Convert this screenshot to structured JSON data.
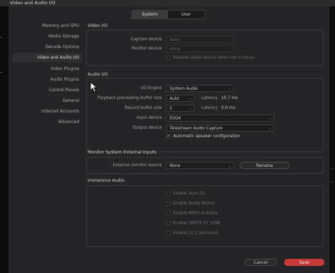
{
  "window": {
    "title": "Video and Audio I/O"
  },
  "tabs": [
    {
      "label": "System",
      "active": true
    },
    {
      "label": "User",
      "active": false
    }
  ],
  "sidebar": {
    "items": [
      {
        "label": "Memory and GPU",
        "active": false
      },
      {
        "label": "Media Storage",
        "active": false
      },
      {
        "label": "Decode Options",
        "active": false
      },
      {
        "label": "Video and Audio I/O",
        "active": true
      },
      {
        "label": "Video Plugins",
        "active": false
      },
      {
        "label": "Audio Plugins",
        "active": false
      },
      {
        "label": "Control Panels",
        "active": false
      },
      {
        "label": "General",
        "active": false
      },
      {
        "label": "Internet Accounts",
        "active": false
      },
      {
        "label": "Advanced",
        "active": false
      }
    ]
  },
  "video_io": {
    "title": "Video I/O",
    "capture_device": {
      "label": "Capture device",
      "value": "None"
    },
    "monitor_device": {
      "label": "Monitor device",
      "value": "None"
    },
    "release_checkbox": {
      "label": "Release video device when not in focus",
      "checked": false
    }
  },
  "audio_io": {
    "title": "Audio I/O",
    "io_engine": {
      "label": "I/O Engine",
      "value": "System Audio"
    },
    "playback_buffer": {
      "label": "Playback processing buffer size",
      "value": "Auto",
      "latency_label": "Latency",
      "latency_value": "10.7 ms"
    },
    "record_buffer": {
      "label": "Record buffer size",
      "value": "5",
      "latency_label": "Latency",
      "latency_value": "0.0 ms"
    },
    "input_device": {
      "label": "Input device",
      "value": "EVO4"
    },
    "output_device": {
      "label": "Output device",
      "value": "Telestream Audio Capture"
    },
    "auto_speaker": {
      "label": "Automatic speaker configuration",
      "checked": true
    }
  },
  "monitor_inputs": {
    "title": "Monitor System External Inputs",
    "source": {
      "label": "External monitor source",
      "value": "None"
    },
    "rename_label": "Rename"
  },
  "immersive_audio": {
    "title": "Immersive Audio",
    "options": [
      {
        "label": "Enable Auro-3D",
        "checked": false
      },
      {
        "label": "Enable Dolby Atmos",
        "checked": false
      },
      {
        "label": "Enable MPEG-H Audio",
        "checked": false
      },
      {
        "label": "Enable SMPTE ST 2098",
        "checked": false
      },
      {
        "label": "Enable 22.2 Surround",
        "checked": false
      }
    ]
  },
  "footer": {
    "cancel_label": "Cancel",
    "save_label": "Save"
  },
  "colors": {
    "accent": "#c73a3a",
    "background": "#252527"
  }
}
